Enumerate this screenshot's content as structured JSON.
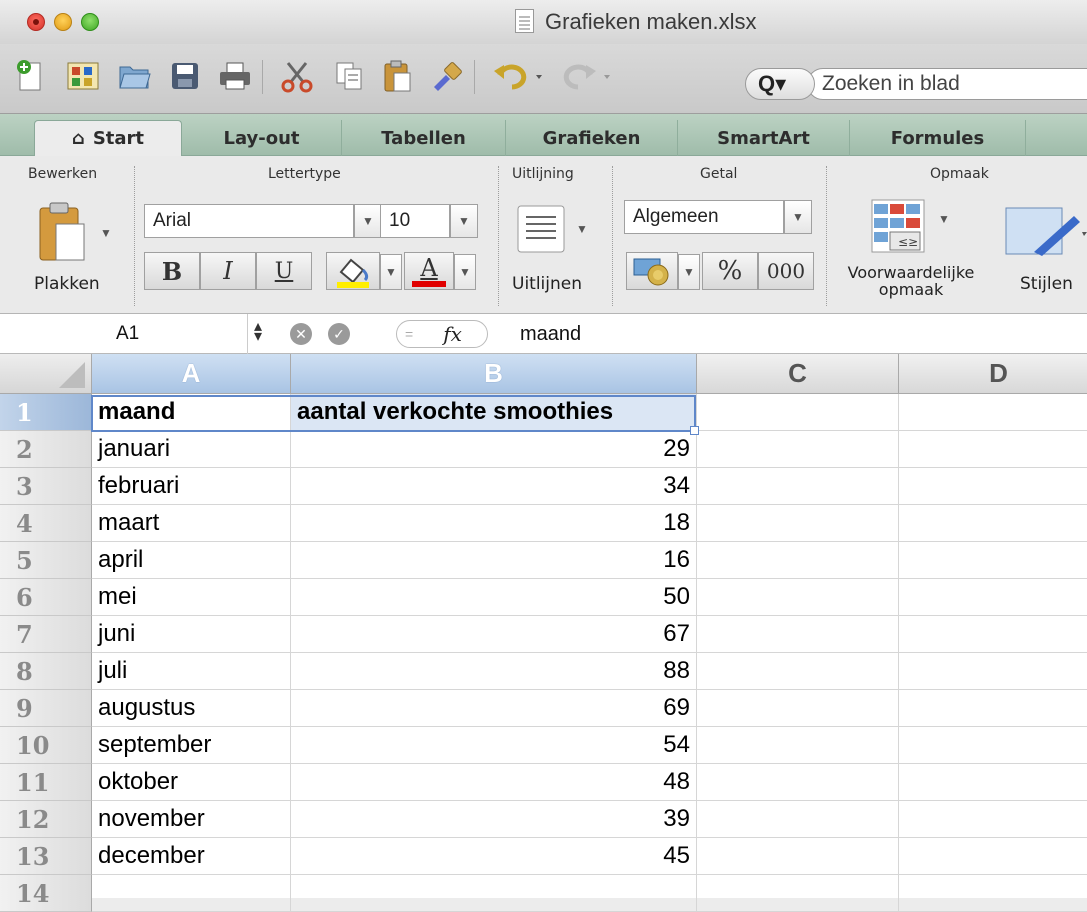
{
  "window": {
    "title": "Grafieken maken.xlsx"
  },
  "toolbar": {
    "search_placeholder": "Zoeken in blad",
    "search_icon_label": "Q▾"
  },
  "tabs": [
    "Start",
    "Lay-out",
    "Tabellen",
    "Grafieken",
    "SmartArt",
    "Formules"
  ],
  "ribbon": {
    "groups": {
      "bewerken": "Bewerken",
      "lettertype": "Lettertype",
      "uitlijning": "Uitlijning",
      "getal": "Getal",
      "opmaak": "Opmaak"
    },
    "paste_label": "Plakken",
    "font_name": "Arial",
    "font_size": "10",
    "bold": "B",
    "italic": "I",
    "underline": "U",
    "font_color_glyph": "A",
    "align_label": "Uitlijnen",
    "number_format": "Algemeen",
    "percent": "%",
    "thousands": "000",
    "conditional_line1": "Voorwaardelijke",
    "conditional_line2": "opmaak",
    "styles_label": "Stijlen"
  },
  "formula_bar": {
    "cell_ref": "A1",
    "fx": "fx",
    "content": "maand"
  },
  "sheet": {
    "columns": [
      "A",
      "B",
      "C",
      "D"
    ],
    "rows": [
      "1",
      "2",
      "3",
      "4",
      "5",
      "6",
      "7",
      "8",
      "9",
      "10",
      "11",
      "12",
      "13",
      "14"
    ],
    "header": [
      "maand",
      "aantal verkochte smoothies"
    ],
    "data": [
      [
        "januari",
        "29"
      ],
      [
        "februari",
        "34"
      ],
      [
        "maart",
        "18"
      ],
      [
        "april",
        "16"
      ],
      [
        "mei",
        "50"
      ],
      [
        "juni",
        "67"
      ],
      [
        "juli",
        "88"
      ],
      [
        "augustus",
        "69"
      ],
      [
        "september",
        "54"
      ],
      [
        "oktober",
        "48"
      ],
      [
        "november",
        "39"
      ],
      [
        "december",
        "45"
      ]
    ]
  },
  "colors": {
    "selection": "#5f87c9",
    "tab_bar": "#a9c4b2",
    "highlight_yellow": "#ffee00",
    "highlight_red": "#e00000"
  }
}
